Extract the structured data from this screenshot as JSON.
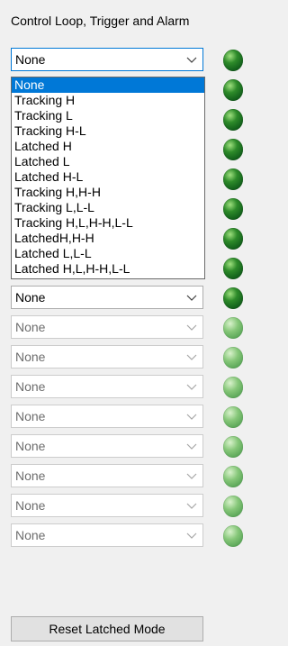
{
  "panel": {
    "title": "Control Loop, Trigger and Alarm"
  },
  "dropdown": {
    "selected": "None",
    "options": [
      "None",
      "Tracking H",
      "Tracking L",
      "Tracking H-L",
      "Latched H",
      "Latched L",
      "Latched H-L",
      "Tracking H,H-H",
      "Tracking L,L-L",
      "Tracking H,L,H-H,L-L",
      "LatchedH,H-H",
      "Latched L,L-L",
      "Latched H,L,H-H,L-L"
    ],
    "highlighted_index": 0
  },
  "rows": [
    {
      "value": "None",
      "state": "enabled",
      "led": "on"
    },
    {
      "value": "None",
      "state": "enabled",
      "led": "on"
    },
    {
      "value": "None",
      "state": "enabled",
      "led": "on"
    },
    {
      "value": "None",
      "state": "enabled",
      "led": "on"
    },
    {
      "value": "None",
      "state": "enabled",
      "led": "on"
    },
    {
      "value": "None",
      "state": "enabled",
      "led": "on"
    },
    {
      "value": "None",
      "state": "enabled",
      "led": "on"
    },
    {
      "value": "None",
      "state": "enabled",
      "led": "on"
    },
    {
      "value": "None",
      "state": "enabled",
      "led": "on"
    },
    {
      "value": "None",
      "state": "disabled",
      "led": "off"
    },
    {
      "value": "None",
      "state": "disabled",
      "led": "off"
    },
    {
      "value": "None",
      "state": "disabled",
      "led": "off"
    },
    {
      "value": "None",
      "state": "disabled",
      "led": "off"
    },
    {
      "value": "None",
      "state": "disabled",
      "led": "off"
    },
    {
      "value": "None",
      "state": "disabled",
      "led": "off"
    },
    {
      "value": "None",
      "state": "disabled",
      "led": "off"
    },
    {
      "value": "None",
      "state": "disabled",
      "led": "off"
    }
  ],
  "reset_button": {
    "label": "Reset Latched Mode"
  },
  "colors": {
    "highlight": "#0078d7",
    "led_on": "#1d7a24",
    "led_off": "#7cc073"
  }
}
